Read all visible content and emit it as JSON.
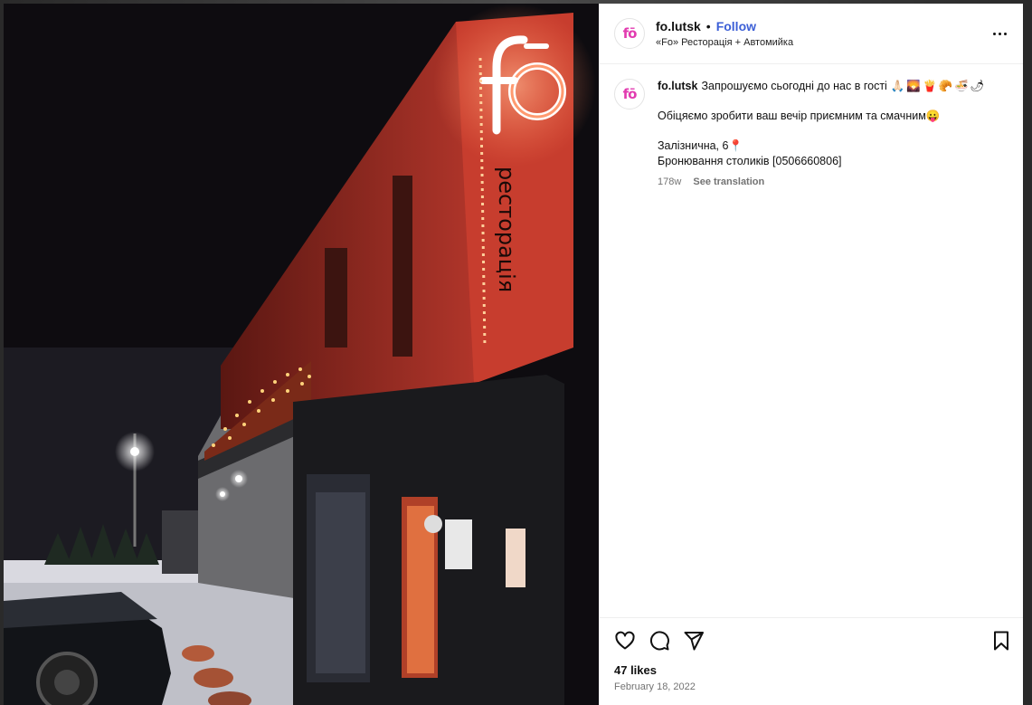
{
  "post": {
    "username": "fo.lutsk",
    "follow_label": "Follow",
    "subtitle": "«Fo» Ресторація + Автомийка",
    "avatar_text": "fō",
    "caption_line1": "Запрошуємо сьогодні до нас в гості",
    "caption_emojis": "🙏🏻🌄🍟🥐🍜🌶",
    "caption_line2": "Обіцяємо зробити ваш вечір приємним та смачним😛",
    "caption_line3": "Залізнична, 6📍",
    "caption_line4": "Бронювання столиків [0506660806]",
    "age": "178w",
    "translate_label": "See translation",
    "likes": "47 likes",
    "date": "February 18, 2022"
  },
  "photo": {
    "sign_logo": "fō",
    "sign_word": "ресторація"
  },
  "icons": [
    "heart-icon",
    "comment-icon",
    "share-icon",
    "bookmark-icon",
    "more-icon"
  ]
}
